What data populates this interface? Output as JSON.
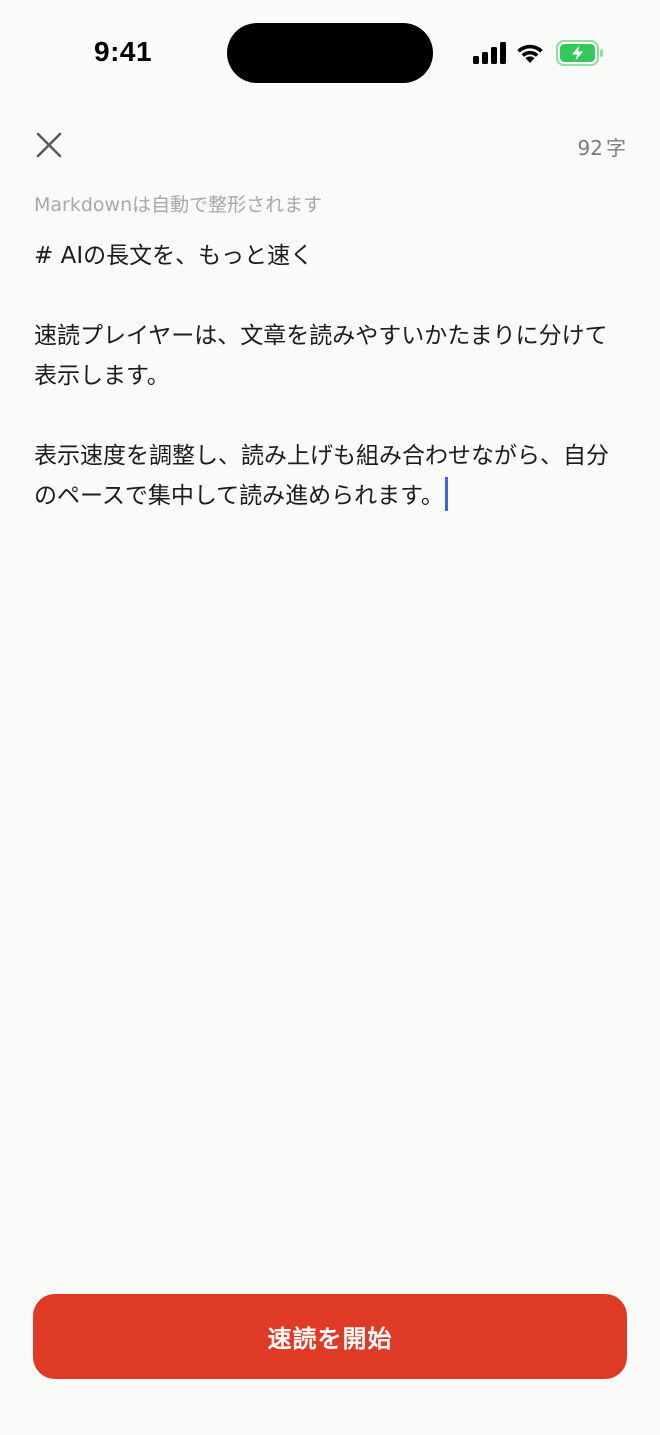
{
  "status_bar": {
    "time": "9:41",
    "icons": [
      "signal-icon",
      "wifi-icon",
      "battery-charging-icon"
    ],
    "battery_color": "#34C759"
  },
  "header": {
    "close_icon": "close-icon",
    "char_count_value": "92",
    "char_count_unit": "字"
  },
  "hint": "Markdownは自動で整形されます",
  "editor": {
    "lines": [
      "# AIの長文を、もっと速く",
      "速読プレイヤーは、文章を読みやすいかたまりに分けて表示します。",
      "表示速度を調整し、読み上げも組み合わせながら、自分のペースで集中して読み進められます。"
    ],
    "caret_color": "#3F63D9"
  },
  "start_button": {
    "label": "速読を開始",
    "color": "#DE3A26"
  }
}
